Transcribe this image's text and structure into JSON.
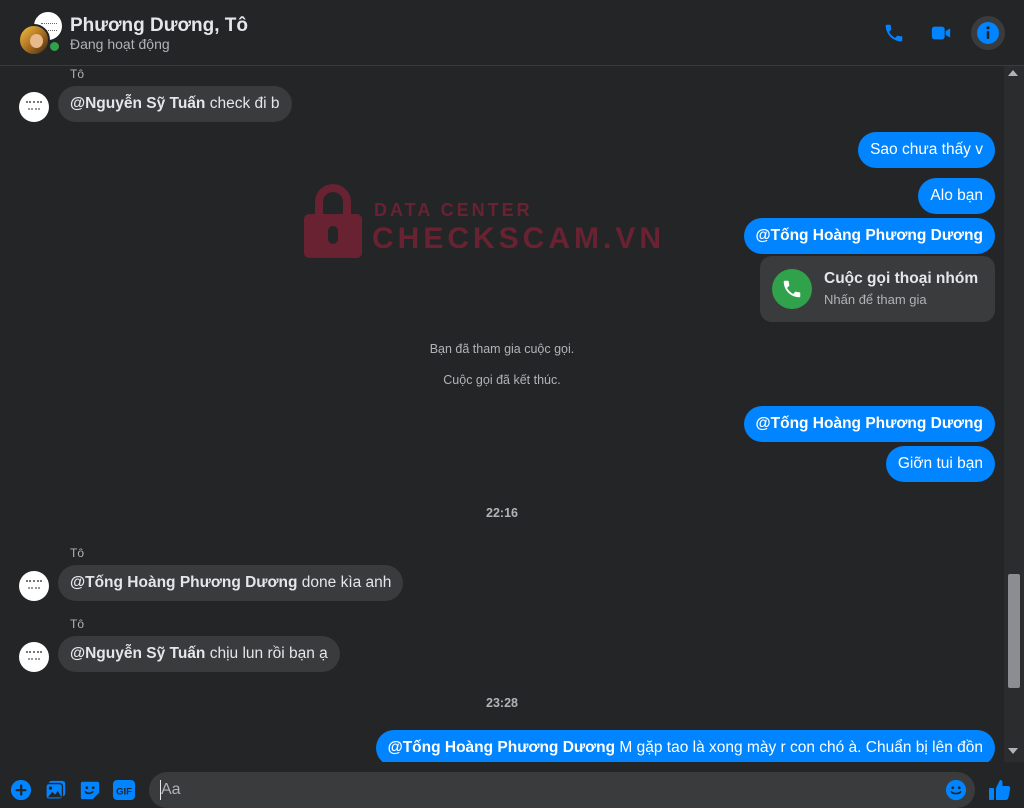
{
  "header": {
    "title": "Phương Dương, Tô",
    "status": "Đang hoạt động",
    "phone_icon": "phone-icon",
    "video_icon": "video-camera-icon",
    "info_icon": "info-icon"
  },
  "watermark": {
    "line1": "DATA CENTER",
    "line2": "CHECKSCAM.VN",
    "icon": "lock-icon"
  },
  "messages": {
    "m1": {
      "sender": "Tô",
      "mention": "@Nguyễn Sỹ Tuấn",
      "text": " check đi b"
    },
    "m2": {
      "text": "Sao chưa thấy v"
    },
    "m3": {
      "text": "Alo bạn"
    },
    "m4": {
      "mention": "@Tống Hoàng Phương Dương"
    },
    "call": {
      "title": "Cuộc gọi thoại nhóm",
      "subtitle": "Nhấn để tham gia"
    },
    "sys1": "Bạn đã tham gia cuộc gọi.",
    "sys2": "Cuộc gọi đã kết thúc.",
    "m5": {
      "mention": "@Tống Hoàng Phương Dương"
    },
    "m6": {
      "text": "Giỡn tui bạn"
    },
    "time1": "22:16",
    "m7": {
      "sender": "Tô",
      "mention": "@Tống Hoàng Phương Dương",
      "text": " done kìa anh"
    },
    "m8": {
      "sender": "Tô",
      "mention": "@Nguyễn Sỹ Tuấn",
      "text": " chịu lun rồi bạn ạ"
    },
    "time2": "23:28",
    "m9": {
      "mention": "@Tống Hoàng Phương Dương",
      "text": " M gặp tao là xong mày r con chó à. Chuẩn bị lên đồn"
    }
  },
  "composer": {
    "placeholder": "Aa",
    "buttons": [
      "plus-icon",
      "image-icon",
      "sticker-icon",
      "gif-icon"
    ],
    "gif_label": "GIF",
    "emoji_icon": "smiley-icon",
    "like_icon": "thumbs-up-icon"
  },
  "colors": {
    "background": "#242526",
    "bubble_in": "#3a3b3c",
    "bubble_out": "#0084ff",
    "accent": "#0084ff",
    "online": "#31a24c",
    "watermark": "#a0213a"
  }
}
